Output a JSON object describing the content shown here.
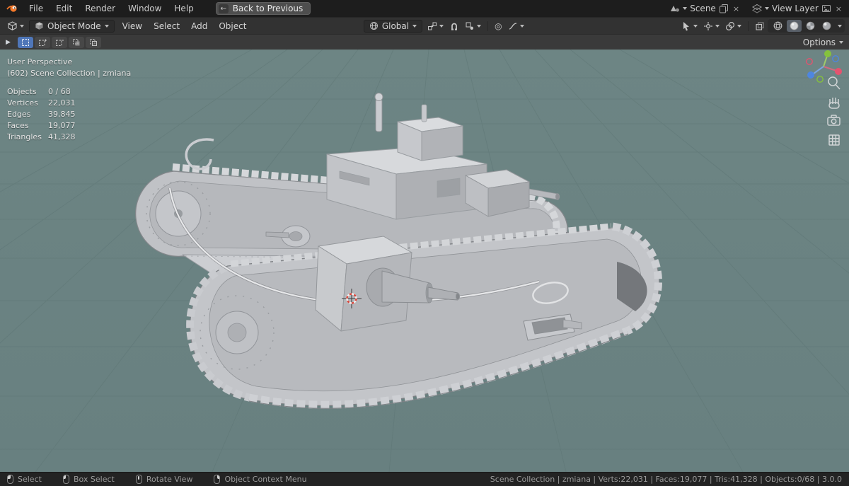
{
  "topbar": {
    "menus": [
      "File",
      "Edit",
      "Render",
      "Window",
      "Help"
    ],
    "back_button": "Back to Previous",
    "scene_label": "Scene",
    "view_layer_label": "View Layer"
  },
  "header": {
    "mode": "Object Mode",
    "menus": [
      "View",
      "Select",
      "Add",
      "Object"
    ],
    "orientation": "Global"
  },
  "toolbar": {
    "options_label": "Options"
  },
  "icons": {
    "back_arrow": "←",
    "close": "×",
    "expand_arrow": "▶",
    "proportional": "◎"
  },
  "viewport": {
    "overlay": {
      "perspective": "User Perspective",
      "collection": "(602) Scene Collection | zmiana",
      "stats": [
        {
          "label": "Objects",
          "value": "0 / 68"
        },
        {
          "label": "Vertices",
          "value": "22,031"
        },
        {
          "label": "Edges",
          "value": "39,845"
        },
        {
          "label": "Faces",
          "value": "19,077"
        },
        {
          "label": "Triangles",
          "value": "41,328"
        }
      ]
    },
    "colors": {
      "background": "#6b8382",
      "grid": "#5c7473",
      "model_light": "#d6d8db",
      "model_mid": "#c3c5c9",
      "model_dark": "#a9abaf",
      "accent": "#4f76b8",
      "axis_x": "#e4536f",
      "axis_y": "#85c23d",
      "axis_z": "#4e86e0"
    }
  },
  "statusbar": {
    "hints": [
      {
        "icon": "mouse-left",
        "label": "Select"
      },
      {
        "icon": "mouse-left",
        "label": "Box Select"
      },
      {
        "icon": "mouse-middle",
        "label": "Rotate View"
      },
      {
        "icon": "mouse-right",
        "label": "Object Context Menu"
      }
    ],
    "info": "Scene Collection | zmiana | Verts:22,031 | Faces:19,077 | Tris:41,328 | Objects:0/68 | 3.0.0"
  }
}
